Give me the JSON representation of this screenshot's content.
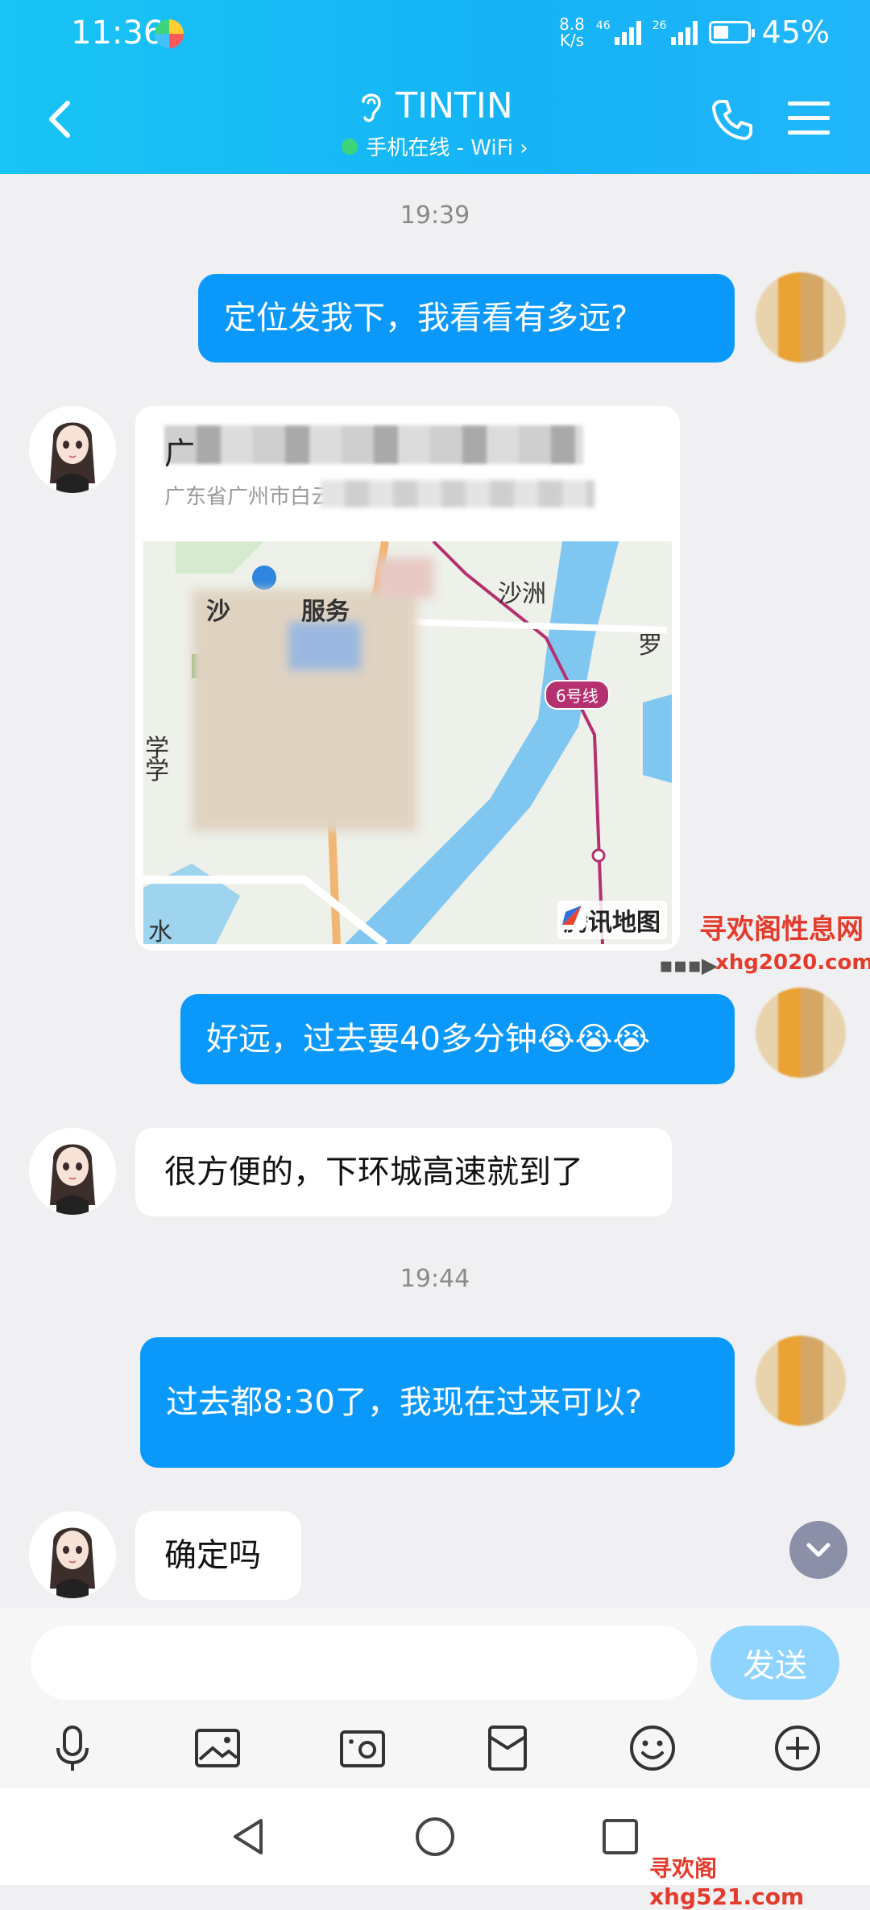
{
  "status_bar": {
    "time": "11:36",
    "net_speed_value": "8.8",
    "net_speed_unit": "K/s",
    "sim1_tag": "46",
    "sim2_tag": "26",
    "battery_percent": 45,
    "battery_label": "45%"
  },
  "header": {
    "title": "TINTIN",
    "subtitle": "手机在线 - WiFi ›",
    "bg_color": "#16b3f7"
  },
  "messages": {
    "time1": "19:39",
    "msg1": "定位发我下，我看看有多远?",
    "location_card": {
      "title_visible": "广",
      "address_visible": "广东省广州市白云",
      "map": {
        "label_district": "沙",
        "label_service": "服务",
        "label_shazhou": "沙洲",
        "label_luo": "罗",
        "label_xue1": "学",
        "label_xue2": "学",
        "label_shui": "水",
        "metro_line": "6号线",
        "logo_text": "腾讯地图"
      }
    },
    "msg2": "好远，过去要40多分钟😭😭😭",
    "msg3": "很方便的，下环城高速就到了",
    "time2": "19:44",
    "msg4": "过去都8:30了，我现在过来可以?",
    "msg5": "确定吗"
  },
  "watermark": {
    "line1": "寻欢阁性息网",
    "line2": "xhg2020.com",
    "arrow": "▪▪▪▶",
    "bottom": "寻欢阁xhg521.com"
  },
  "input": {
    "placeholder": "",
    "send_label": "发送"
  },
  "toolbar_icons": [
    "microphone-icon",
    "gallery-icon",
    "camera-icon",
    "red-envelope-icon",
    "emoji-icon",
    "plus-icon"
  ],
  "nav_icons": [
    "back-triangle-icon",
    "home-circle-icon",
    "recents-square-icon"
  ],
  "colors": {
    "bubble_out": "#0a99fb",
    "bubble_in": "#ffffff",
    "send_button": "#8fd3ff",
    "watermark": "#e53b2c"
  }
}
